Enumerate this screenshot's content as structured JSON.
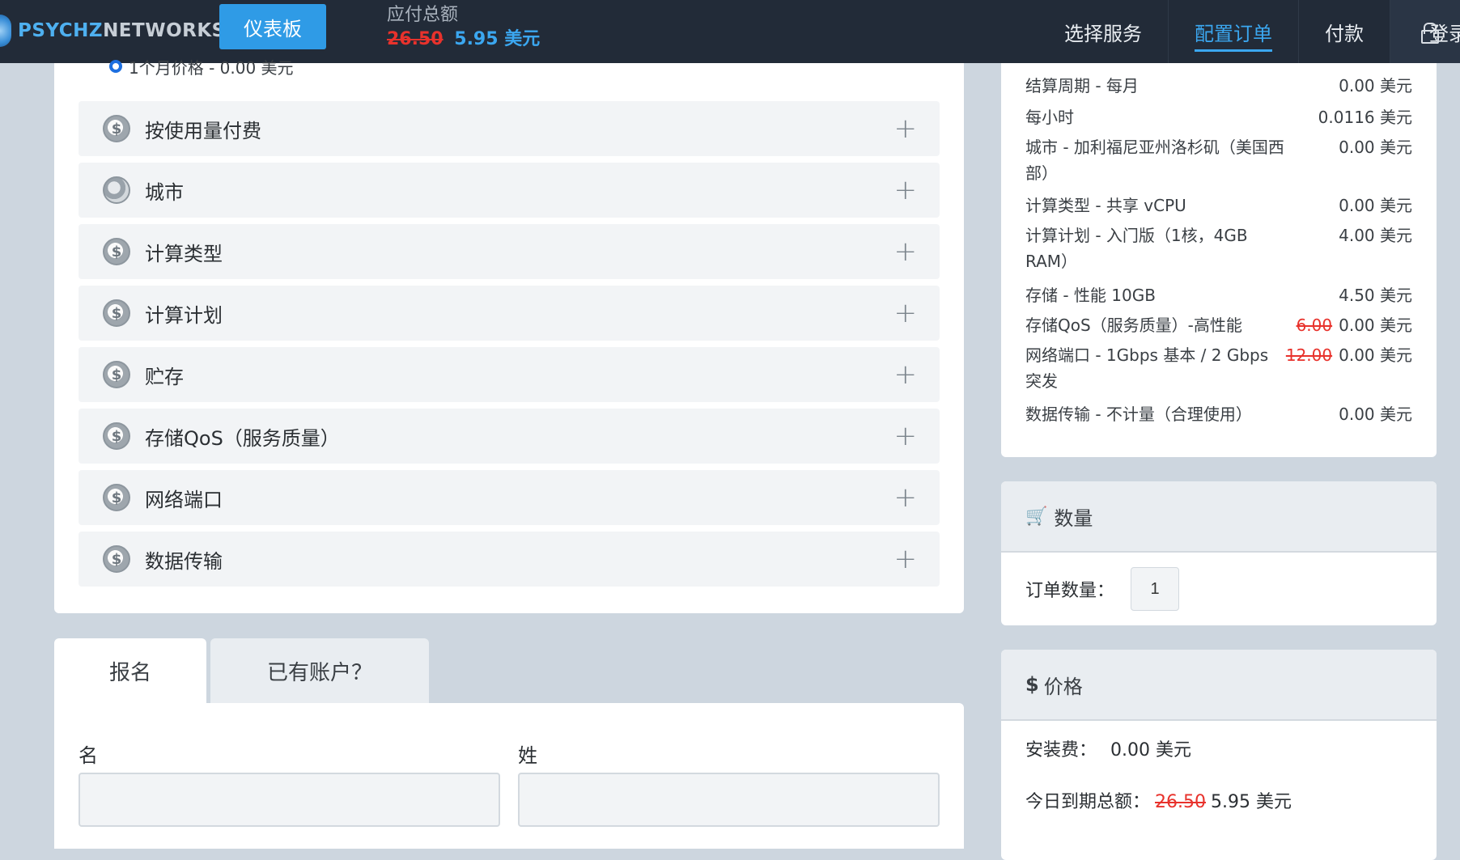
{
  "nav": {
    "logo_part1": "PSYCHZ",
    "logo_part2": "NETWORKS",
    "dashboard": "仪表板",
    "due_label": "应付总额",
    "due_old": "26.50",
    "due_new": "5.95 美元",
    "links": [
      "选择服务",
      "配置订单",
      "付款"
    ],
    "login": "登录"
  },
  "config": {
    "radio_option": "1个月价格 - 0.00 美元",
    "sections": [
      {
        "label": "按使用量付费",
        "icon": "dollar-coin-icon"
      },
      {
        "label": "城市",
        "icon": "globe-icon"
      },
      {
        "label": "计算类型",
        "icon": "dollar-coin-icon"
      },
      {
        "label": "计算计划",
        "icon": "dollar-coin-icon"
      },
      {
        "label": "贮存",
        "icon": "dollar-coin-icon"
      },
      {
        "label": "存储QoS（服务质量）",
        "icon": "dollar-coin-icon"
      },
      {
        "label": "网络端口",
        "icon": "dollar-coin-icon"
      },
      {
        "label": "数据传输",
        "icon": "dollar-coin-icon"
      }
    ],
    "expand_symbol": "+"
  },
  "signup": {
    "tab_signup": "报名",
    "tab_existing": "已有账户？",
    "first_name_label": "名",
    "last_name_label": "姓",
    "first_name_value": "",
    "last_name_value": ""
  },
  "summary": {
    "rows": [
      {
        "desc": "结算周期 - 每月",
        "old": "",
        "price": "0.00 美元"
      },
      {
        "desc": "每小时",
        "old": "",
        "price": "0.0116 美元"
      },
      {
        "desc": "城市 - 加利福尼亚州洛杉矶（美国西部）",
        "old": "",
        "price": "0.00 美元"
      },
      {
        "desc": "计算类型 - 共享 vCPU",
        "old": "",
        "price": "0.00 美元"
      },
      {
        "desc": "计算计划 - 入门版（1核，4GB RAM）",
        "old": "",
        "price": "4.00 美元"
      },
      {
        "desc": "存储 - 性能 10GB",
        "old": "",
        "price": "4.50 美元"
      },
      {
        "desc": "存储QoS（服务质量）-高性能",
        "old": "6.00",
        "price": "0.00 美元"
      },
      {
        "desc": "网络端口 - 1Gbps 基本 / 2 Gbps 突发",
        "old": "12.00",
        "price": "0.00 美元"
      },
      {
        "desc": "数据传输 - 不计量（合理使用）",
        "old": "",
        "price": "0.00 美元"
      }
    ]
  },
  "quantity": {
    "title": "数量",
    "label": "订单数量：",
    "value": "1"
  },
  "price": {
    "title": "价格",
    "setup_label": "安装费：",
    "setup_value": "0.00 美元",
    "total_label": "今日到期总额：",
    "total_old": "26.50",
    "total_new": "5.95 美元"
  },
  "colors": {
    "navbar": "#222b38",
    "accent": "#3ba7f0",
    "strike": "#e8322c",
    "background": "#cdd6df"
  }
}
